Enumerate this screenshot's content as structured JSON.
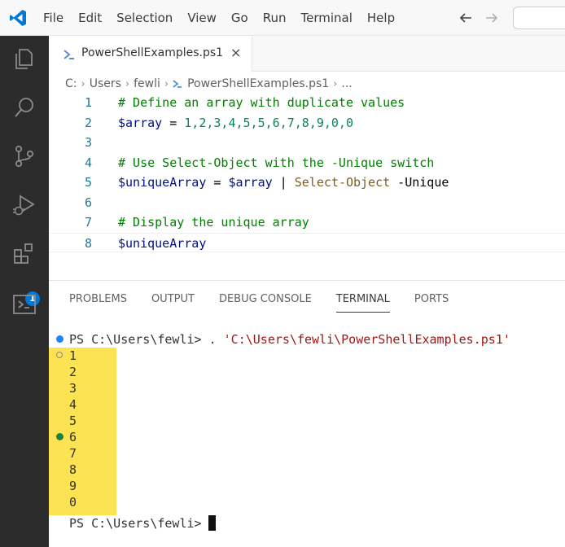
{
  "menu": [
    "File",
    "Edit",
    "Selection",
    "View",
    "Go",
    "Run",
    "Terminal",
    "Help"
  ],
  "activity_bar": {
    "icons": [
      "explorer-icon",
      "search-icon",
      "source-control-icon",
      "run-debug-icon",
      "extensions-icon",
      "remote-explorer-icon"
    ],
    "extensions_badge": "1"
  },
  "tab": {
    "label": "PowerShellExamples.ps1",
    "close": "×"
  },
  "breadcrumb": {
    "items": [
      "C:",
      "Users",
      "fewli",
      "PowerShellExamples.ps1",
      "..."
    ]
  },
  "editor": {
    "lines": [
      {
        "num": "1",
        "tokens": [
          {
            "t": "# Define an array with duplicate values",
            "c": "c-comment"
          }
        ]
      },
      {
        "num": "2",
        "tokens": [
          {
            "t": "$array",
            "c": "c-var"
          },
          {
            "t": " = ",
            "c": "c-op"
          },
          {
            "t": "1,2,3,4,5,5,6,7,8,9,0,0",
            "c": "c-num"
          }
        ]
      },
      {
        "num": "3",
        "tokens": []
      },
      {
        "num": "4",
        "tokens": [
          {
            "t": "# Use Select-Object with the -Unique switch",
            "c": "c-comment"
          }
        ]
      },
      {
        "num": "5",
        "tokens": [
          {
            "t": "$uniqueArray",
            "c": "c-var"
          },
          {
            "t": " = ",
            "c": "c-op"
          },
          {
            "t": "$array",
            "c": "c-var"
          },
          {
            "t": " | ",
            "c": "c-op"
          },
          {
            "t": "Select-Object",
            "c": "c-cmd"
          },
          {
            "t": " -Unique",
            "c": "c-param"
          }
        ]
      },
      {
        "num": "6",
        "tokens": []
      },
      {
        "num": "7",
        "tokens": [
          {
            "t": "# Display the unique array",
            "c": "c-comment"
          }
        ]
      },
      {
        "num": "8",
        "tokens": [
          {
            "t": "$uniqueArray",
            "c": "c-var"
          }
        ]
      }
    ]
  },
  "panel": {
    "tabs": [
      "PROBLEMS",
      "OUTPUT",
      "DEBUG CONSOLE",
      "TERMINAL",
      "PORTS"
    ],
    "active_tab": "TERMINAL"
  },
  "terminal": {
    "prompt_text": "PS C:\\Users\\fewli> . ",
    "script_path": "'C:\\Users\\fewli\\PowerShellExamples.ps1'",
    "output": [
      "1",
      "2",
      "3",
      "4",
      "5",
      "6",
      "7",
      "8",
      "9",
      "0"
    ],
    "final_prompt": "PS C:\\Users\\fewli> "
  }
}
